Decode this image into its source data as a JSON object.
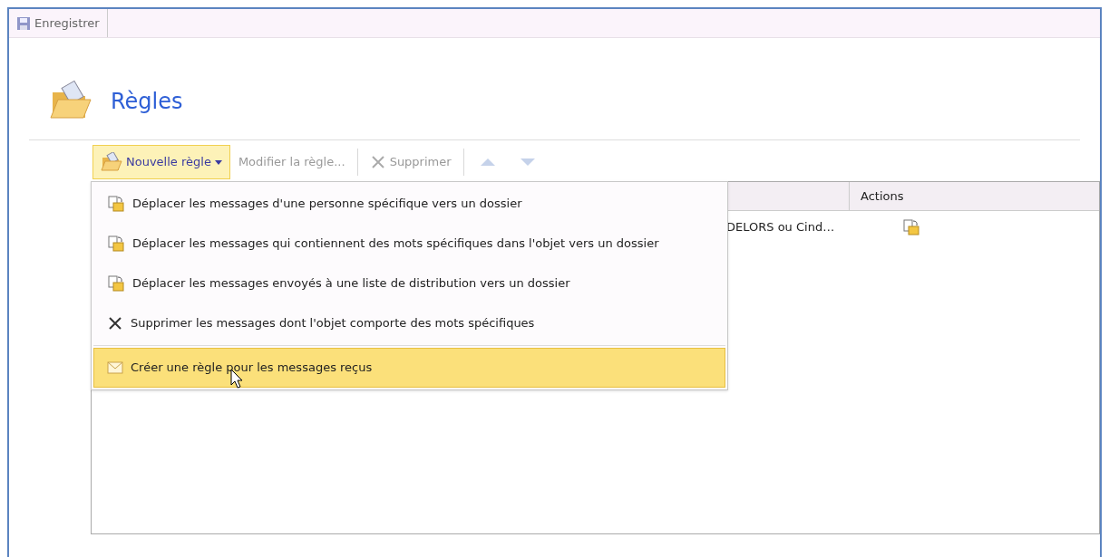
{
  "toolbar": {
    "save_button": "Enregistrer"
  },
  "page": {
    "title": "Règles"
  },
  "actions": [
    {
      "kind": "new",
      "label": "Nouvelle règle",
      "selected": true,
      "disabled": false
    },
    {
      "kind": "edit",
      "label": "Modifier la règle...",
      "selected": false,
      "disabled": true
    },
    {
      "kind": "delete",
      "label": "Supprimer",
      "selected": false,
      "disabled": true
    },
    {
      "kind": "up",
      "selected": false,
      "disabled": true
    },
    {
      "kind": "down",
      "selected": false,
      "disabled": true
    }
  ],
  "table": {
    "columns": [
      "Actions"
    ],
    "rows": [
      {
        "column_2": "DELORS ou Cind…",
        "kind": "move"
      }
    ]
  },
  "menu": {
    "items": [
      {
        "kind": "move",
        "label": "Déplacer les messages d'une personne spécifique vers un dossier",
        "selected": false
      },
      {
        "kind": "move",
        "label": "Déplacer les messages qui contiennent des mots spécifiques dans l'objet vers un dossier",
        "selected": false
      },
      {
        "kind": "move",
        "label": "Déplacer les messages envoyés à une liste de distribution vers un dossier",
        "selected": false
      },
      {
        "kind": "delete",
        "label": "Supprimer les messages dont l'objet comporte des mots spécifiques",
        "selected": false
      },
      {
        "kind": "mail",
        "label": "Créer une règle pour les messages reçus",
        "selected": true
      }
    ]
  }
}
